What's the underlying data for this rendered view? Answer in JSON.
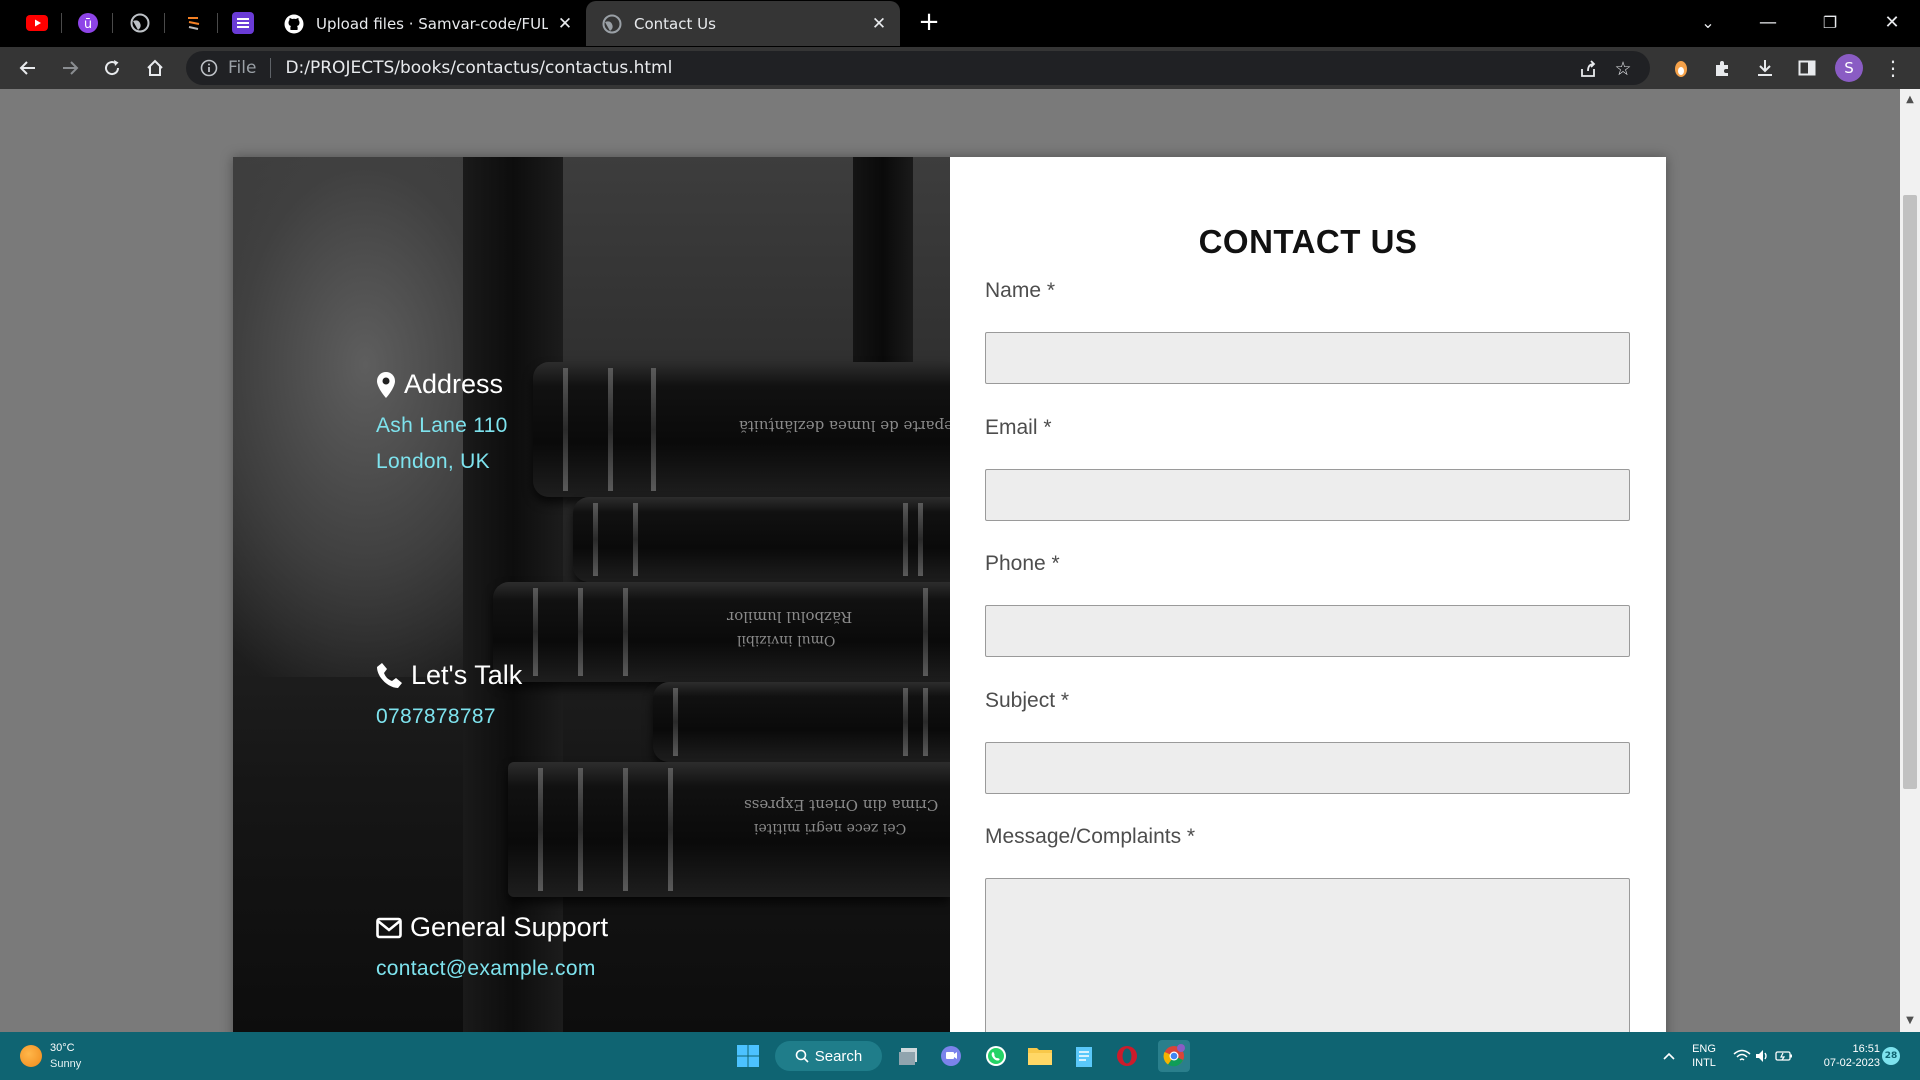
{
  "browser": {
    "tabs": [
      {
        "title": "Upload files · Samvar-code/FULL_ST",
        "active": false
      },
      {
        "title": "Contact Us",
        "active": true
      }
    ],
    "omnibox": {
      "scheme_label": "File",
      "url": "D:/PROJECTS/books/contactus/contactus.html"
    },
    "profile_initial": "S"
  },
  "page": {
    "left": {
      "address": {
        "heading": "Address",
        "line1": "Ash Lane 110",
        "line2": "London, UK"
      },
      "talk": {
        "heading": "Let's Talk",
        "phone": "0787878787"
      },
      "support": {
        "heading": "General Support",
        "email": "contact@example.com"
      },
      "book_titles": [
        "Departe de lumea dezlănțuită",
        "Războlul lumilor",
        "Omul invizibil",
        "Crima din Orient Express",
        "Cei zece negri mititei"
      ]
    },
    "form": {
      "title": "CONTACT US",
      "fields": {
        "name": "Name *",
        "email": "Email *",
        "phone": "Phone *",
        "subject": "Subject *",
        "message": "Message/Complaints *"
      }
    }
  },
  "taskbar": {
    "weather": {
      "temp": "30°C",
      "desc": "Sunny"
    },
    "search_label": "Search",
    "lang": "ENG",
    "layout": "INTL",
    "time": "16:51",
    "date": "07-02-2023",
    "notifications": "28"
  },
  "colors": {
    "accent_text": "#7ee3ee",
    "taskbar": "#0f6472",
    "viewport_bg": "#7a7a7a"
  }
}
